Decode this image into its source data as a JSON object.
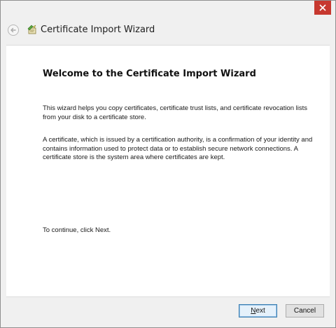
{
  "window": {
    "title": "Certificate Import Wizard"
  },
  "content": {
    "heading": "Welcome to the Certificate Import Wizard",
    "paragraph1": "This wizard helps you copy certificates, certificate trust lists, and certificate revocation lists from your disk to a certificate store.",
    "paragraph2": "A certificate, which is issued by a certification authority, is a confirmation of your identity and contains information used to protect data or to establish secure network connections. A certificate store is the system area where certificates are kept.",
    "paragraph3": "To continue, click Next."
  },
  "buttons": {
    "next": "Next",
    "cancel": "Cancel"
  },
  "icons": {
    "close": "close-icon",
    "back": "back-arrow-icon",
    "wizard": "certificate-wizard-icon"
  },
  "colors": {
    "close_button": "#c7382f",
    "default_button_border": "#3c7fb1"
  }
}
